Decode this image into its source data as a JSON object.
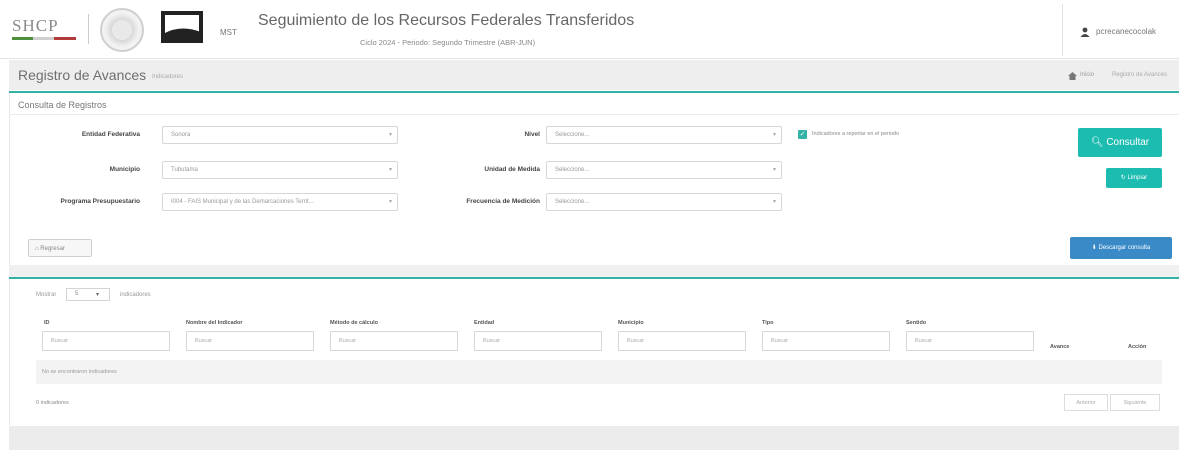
{
  "header": {
    "logo_text": "SHCP",
    "mst_label": "MST",
    "title": "Seguimiento de los Recursos Federales Transferidos",
    "subtitle": "Ciclo 2024 - Periodo: Segundo Trimestre (ABR-JUN)",
    "user_name": "pcrecanecocolak"
  },
  "page": {
    "title": "Registro de Avances",
    "title_small": "Indicadores",
    "breadcrumb": {
      "home": "Inicio",
      "current": "Registro de Avances"
    }
  },
  "filters": {
    "heading": "Consulta de Registros",
    "entidad": {
      "label": "Entidad Federativa",
      "value": "Sonora"
    },
    "municipio": {
      "label": "Municipio",
      "value": "Tubutama"
    },
    "programa": {
      "label": "Programa Presupuestario",
      "value": "I004 - FAIS Municipal y de las Demarcaciones Territ..."
    },
    "nivel": {
      "label": "Nivel",
      "value": "Seleccione..."
    },
    "unidad": {
      "label": "Unidad de Medida",
      "value": "Seleccione..."
    },
    "frecuencia": {
      "label": "Frecuencia de Medición",
      "value": "Seleccione..."
    },
    "checkbox_label": "Indicadores a reportar en el periodo",
    "checkbox_checked": true,
    "consultar": "Consultar",
    "limpiar": "Limpiar",
    "regresar": "Regresar",
    "descargar": "Descargar consulta"
  },
  "table": {
    "show_prefix": "Mostrar",
    "show_value": "5",
    "show_suffix": "indicadores",
    "columns": [
      "ID",
      "Nombre del Indicador",
      "Método de cálculo",
      "Entidad",
      "Municipio",
      "Tipo",
      "Sentido",
      "Avance",
      "Acción"
    ],
    "search_placeholder": "Buscar",
    "empty_message": "No se encontraron indicadores",
    "count": "0 indicadores",
    "prev": "Anterior",
    "next": "Siguiente"
  },
  "colors": {
    "teal": "#1dbcb0",
    "blue": "#3a8ac8"
  }
}
